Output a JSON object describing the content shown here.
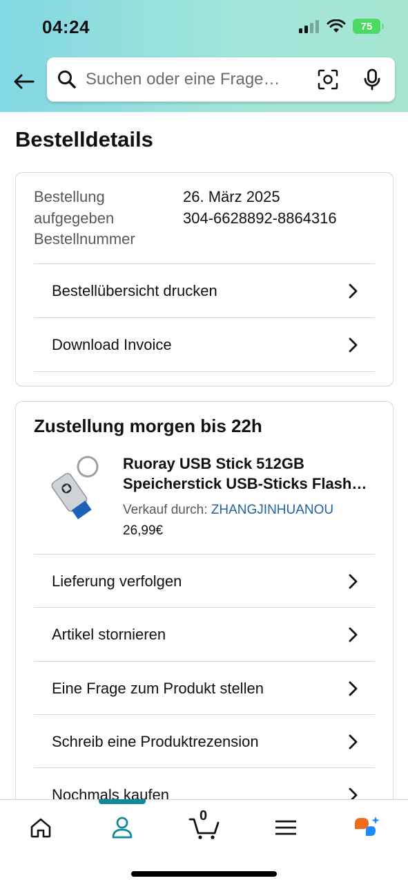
{
  "status_bar": {
    "time": "04:24",
    "battery": "75"
  },
  "search": {
    "placeholder": "Suchen oder eine Frage…"
  },
  "page": {
    "title": "Bestelldetails"
  },
  "order_info": {
    "labels": [
      "Bestellung",
      "aufgegeben",
      "Bestellnummer"
    ],
    "date": "26. März 2025",
    "order_number": "304-6628892-8864316"
  },
  "order_actions": [
    {
      "label": "Bestellübersicht drucken"
    },
    {
      "label": "Download Invoice"
    }
  ],
  "delivery": {
    "title": "Zustellung morgen bis 22h",
    "product": {
      "title_line1": "Ruoray USB Stick 512GB",
      "title_line2": "Speicherstick USB-Sticks Flash…",
      "seller_prefix": "Verkauf durch: ",
      "seller_name": "ZHANGJINHUANOU",
      "price": "26,99€"
    },
    "actions": [
      {
        "label": "Lieferung verfolgen"
      },
      {
        "label": "Artikel stornieren"
      },
      {
        "label": "Eine Frage zum Produkt stellen"
      },
      {
        "label": "Schreib eine Produktrezension"
      },
      {
        "label": "Nochmals kaufen"
      }
    ]
  },
  "bottom_nav": {
    "items": [
      "home-icon",
      "account-icon",
      "cart-icon",
      "menu-icon",
      "rufus-icon"
    ],
    "cart_count": "0",
    "active": "account"
  },
  "colors": {
    "accent": "#0e8a9c",
    "link": "#2162a1",
    "header_start": "#82d8e3",
    "header_end": "#a7e6d2"
  }
}
